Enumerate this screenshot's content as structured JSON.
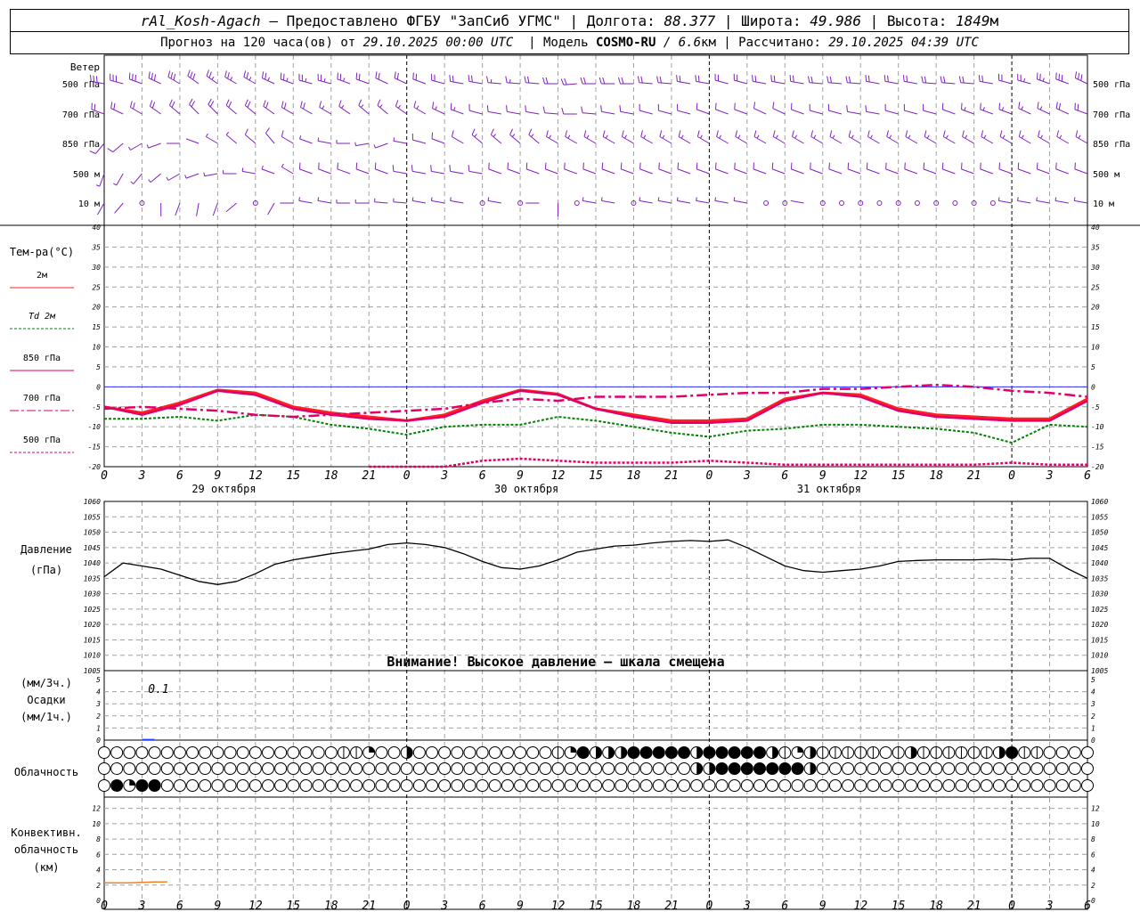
{
  "header": {
    "station": "rAl_Kosh-Agach",
    "provider": "– Предоставлено ФГБУ \"ЗапСиб УГМС\"",
    "lon_label": "Долгота:",
    "lon": "88.377",
    "lat_label": "Широта:",
    "lat": "49.986",
    "alt_label": "Высота:",
    "alt": "1849",
    "alt_unit": "м",
    "forecast_label": "Прогноз на 120 часа(ов) от",
    "forecast_start": "29.10.2025 00:00 UTC",
    "model_label": "Модель",
    "model": "COSMO-RU",
    "model_res": "/ 6.6",
    "model_res_unit": "км",
    "computed_label": "Рассчитано:",
    "computed": "29.10.2025 04:39 UTC"
  },
  "wind_panel": {
    "title": "Ветер",
    "levels": [
      "500 гПа",
      "700 гПа",
      "850 гПа",
      "500 м",
      "10 м"
    ]
  },
  "temp_panel": {
    "title": "Тем-ра(°C)",
    "legend": [
      {
        "label": "2м",
        "color": "#ff2020",
        "dash": "solid"
      },
      {
        "label": "Td 2м",
        "color": "#008000",
        "dash": "dotted"
      },
      {
        "label": "850 гПа",
        "color": "#e0006a",
        "dash": "solid"
      },
      {
        "label": "700 гПа",
        "color": "#e0006a",
        "dash": "dashdot"
      },
      {
        "label": "500 гПа",
        "color": "#e0006a",
        "dash": "dotted"
      }
    ]
  },
  "pressure_panel": {
    "title": "Давление",
    "unit": "(гПа)",
    "warning": "Внимание! Высокое давление – шкала смещена"
  },
  "precip_panel": {
    "unit1": "(мм/3ч.)",
    "title": "Осадки",
    "unit2": "(мм/1ч.)",
    "annotation": "0.1"
  },
  "cloud_panel": {
    "title": "Облачность"
  },
  "conv_panel": {
    "title1": "Конвективн.",
    "title2": "облачность",
    "unit": "(км)"
  },
  "time_axis": {
    "hour_labels": [
      "0",
      "3",
      "6",
      "9",
      "12",
      "15",
      "18",
      "21",
      "0",
      "3",
      "6",
      "9",
      "12",
      "15",
      "18",
      "21",
      "0",
      "3",
      "6",
      "9",
      "12",
      "15",
      "18",
      "21",
      "0",
      "3",
      "6"
    ],
    "day_labels": [
      "29 октября",
      "30 октября",
      "31 октября"
    ]
  },
  "colors": {
    "wind": "#8020c0",
    "t2m": "#ff2020",
    "td2m": "#008000",
    "upper": "#e0006a",
    "pressure": "#000000",
    "conv": "#f08020",
    "freezing_line": "#3030ff",
    "grid": "#a0a0a0"
  },
  "chart_data": [
    {
      "type": "line",
      "title": "Тем-ра(°C)",
      "ylim": [
        -20,
        40
      ],
      "yticks": [
        -20,
        -15,
        -10,
        -5,
        0,
        5,
        10,
        15,
        20,
        25,
        30,
        35,
        40
      ],
      "x_hours": [
        0,
        3,
        6,
        9,
        12,
        15,
        18,
        21,
        24,
        27,
        30,
        33,
        36,
        39,
        42,
        45,
        48,
        51,
        54,
        57,
        60,
        63,
        66,
        69,
        72,
        75,
        78
      ],
      "series": [
        {
          "name": "2м",
          "values": [
            -5,
            -6.5,
            -4,
            -0.8,
            -1.5,
            -5,
            -6.5,
            -7.5,
            -8.5,
            -7,
            -3.5,
            -0.8,
            -1.8,
            -5.5,
            -7,
            -8.5,
            -8.5,
            -8,
            -3,
            -1.5,
            -2,
            -5.5,
            -7,
            -7.5,
            -8,
            -8,
            -3
          ]
        },
        {
          "name": "Td 2м",
          "values": [
            -8,
            -8,
            -7.5,
            -8.5,
            -7,
            -7.5,
            -9.5,
            -10.5,
            -12,
            -10,
            -9.5,
            -9.5,
            -7.5,
            -8.5,
            -10,
            -11.5,
            -12.5,
            -11,
            -10.5,
            -9.5,
            -9.5,
            -10,
            -10.5,
            -11.5,
            -14,
            -9.5,
            -10
          ]
        },
        {
          "name": "850 гПа",
          "values": [
            -5,
            -7,
            -4.5,
            -1,
            -2,
            -5.5,
            -7,
            -8,
            -8.5,
            -7.5,
            -4,
            -1,
            -2,
            -5.5,
            -7.5,
            -9,
            -9,
            -8.5,
            -3.5,
            -1.5,
            -2.5,
            -6,
            -7.5,
            -8,
            -8.5,
            -8.5,
            -3.5
          ]
        },
        {
          "name": "700 гПа",
          "values": [
            -5.5,
            -5,
            -5.5,
            -6,
            -7,
            -7.5,
            -7,
            -6.5,
            -6,
            -5.5,
            -4,
            -3,
            -3.5,
            -2.5,
            -2.5,
            -2.5,
            -2,
            -1.5,
            -1.5,
            -0.5,
            -0.5,
            0,
            0.5,
            0,
            -1,
            -1.5,
            -2.5
          ]
        },
        {
          "name": "500 гПа",
          "values": [
            null,
            null,
            null,
            null,
            null,
            null,
            null,
            -20,
            -20,
            -20,
            -18.5,
            -18,
            -18.5,
            -19,
            -19,
            -19,
            -18.5,
            -19,
            -19.5,
            -19.5,
            -19.5,
            -19.5,
            -19.5,
            -19.5,
            -19,
            -19.5,
            -19.5
          ]
        }
      ]
    },
    {
      "type": "line",
      "title": "Давление",
      "ylim": [
        1005,
        1060
      ],
      "yticks": [
        1005,
        1010,
        1015,
        1020,
        1025,
        1030,
        1035,
        1040,
        1045,
        1050,
        1055,
        1060
      ],
      "x_hours": [
        0,
        1.5,
        3,
        4.5,
        6,
        7.5,
        9,
        10.5,
        12,
        13.5,
        15,
        16.5,
        18,
        19.5,
        21,
        22.5,
        24,
        25.5,
        27,
        28.5,
        30,
        31.5,
        33,
        34.5,
        36,
        37.5,
        39,
        40.5,
        42,
        43.5,
        45,
        46.5,
        48,
        49.5,
        51,
        52.5,
        54,
        55.5,
        57,
        58.5,
        60,
        61.5,
        63,
        64.5,
        66,
        67.5,
        69,
        70.5,
        72,
        73.5,
        75,
        76.5,
        78
      ],
      "series": [
        {
          "name": "Давление",
          "values": [
            1035.5,
            1040,
            1039,
            1038,
            1036,
            1034,
            1033,
            1034,
            1036.5,
            1039.5,
            1041,
            1042,
            1043,
            1043.8,
            1044.5,
            1046,
            1046.5,
            1046,
            1045,
            1043,
            1040.5,
            1038.5,
            1038,
            1039,
            1041,
            1043.5,
            1044.5,
            1045.5,
            1045.8,
            1046.5,
            1047,
            1047.3,
            1047,
            1047.5,
            1045,
            1042,
            1039,
            1037.5,
            1037,
            1037.5,
            1038,
            1039,
            1040.5,
            1040.8,
            1041,
            1041,
            1041,
            1041.2,
            1041,
            1041.5,
            1041.5,
            1038,
            1035
          ]
        }
      ]
    },
    {
      "type": "bar",
      "title": "Осадки",
      "ylim": [
        0,
        5
      ],
      "yticks": [
        0,
        1,
        2,
        3,
        4,
        5
      ],
      "x_hours": [
        3
      ],
      "values": [
        0.1
      ]
    },
    {
      "type": "line",
      "title": "Конвективн. облачность",
      "ylim": [
        0,
        13
      ],
      "yticks": [
        0,
        2,
        4,
        6,
        8,
        10,
        12
      ],
      "x_hours": [
        0,
        1,
        2,
        3,
        4,
        5
      ],
      "series": [
        {
          "name": "Конвективн. облачность",
          "values": [
            2.3,
            2.3,
            2.3,
            2.35,
            2.4,
            2.4
          ]
        }
      ]
    },
    {
      "type": "table",
      "title": "Облачность",
      "step_hours": 1,
      "rows": [
        {
          "level": "upper",
          "values": "0000000000000000000112003000000000001243334444434444431231111101311111134110000000000000000000000000000000000000"
        },
        {
          "level": "middle",
          "values": "0000000000000000000000000000000000000000000000033444444430000000000000000000000000000000000000000000000000000000"
        },
        {
          "level": "low",
          "values": "0424400000000000000000000000000000000000000000000000000000000000000000000000000000000000000000000000000000000000"
        }
      ]
    },
    {
      "type": "scatter",
      "title": "Ветер",
      "note": "direction in degrees (from), speed in m/s, every 1.5 h",
      "x_hours_step": 1.5,
      "levels": [
        {
          "level": "500 гПа",
          "dir": [
            280,
            285,
            290,
            295,
            300,
            305,
            305,
            300,
            300,
            295,
            290,
            285,
            285,
            290,
            290,
            295,
            295,
            290,
            285,
            280,
            280,
            275,
            275,
            275,
            270,
            265,
            270,
            270,
            270,
            275,
            275,
            280,
            280,
            285,
            285,
            280,
            280,
            280,
            275,
            275,
            275,
            280,
            280,
            280,
            275,
            275,
            275,
            280,
            285,
            285,
            290,
            290,
            295
          ],
          "spd": [
            17,
            17,
            16,
            16,
            15,
            15,
            14,
            14,
            14,
            14,
            13,
            13,
            13,
            13,
            12,
            12,
            12,
            12,
            12,
            12,
            10,
            9,
            9,
            10,
            10,
            10,
            10,
            11,
            11,
            11,
            10,
            10,
            10,
            11,
            11,
            11,
            10,
            10,
            10,
            11,
            11,
            11,
            10,
            10,
            10,
            11,
            11,
            11,
            12,
            13,
            14,
            15,
            16
          ]
        },
        {
          "level": "700 гПа",
          "dir": [
            290,
            295,
            300,
            305,
            310,
            315,
            315,
            310,
            310,
            305,
            300,
            300,
            300,
            305,
            310,
            310,
            305,
            300,
            295,
            290,
            285,
            280,
            280,
            280,
            275,
            270,
            275,
            280,
            280,
            285,
            285,
            285,
            290,
            290,
            290,
            295,
            295,
            290,
            285,
            285,
            280,
            280,
            285,
            285,
            285,
            290,
            290,
            290,
            290,
            295,
            295,
            295,
            290
          ],
          "spd": [
            12,
            12,
            12,
            12,
            12,
            12,
            11,
            11,
            11,
            10,
            10,
            10,
            9,
            9,
            9,
            8,
            8,
            8,
            8,
            8,
            6,
            6,
            6,
            6,
            7,
            7,
            7,
            7,
            7,
            6,
            6,
            6,
            7,
            7,
            7,
            7,
            7,
            7,
            7,
            7,
            7,
            7,
            7,
            7,
            7,
            7,
            8,
            8,
            8,
            9,
            9,
            10,
            10
          ]
        },
        {
          "level": "850 гПа",
          "dir": [
            220,
            230,
            240,
            250,
            270,
            290,
            300,
            310,
            310,
            320,
            300,
            290,
            280,
            270,
            260,
            250,
            280,
            285,
            290,
            300,
            310,
            310,
            310,
            310,
            300,
            300,
            300,
            300,
            300,
            300,
            300,
            300,
            300,
            300,
            300,
            300,
            300,
            300,
            300,
            300,
            300,
            300,
            300,
            300,
            300,
            300,
            300,
            300,
            300,
            300,
            300,
            300,
            300
          ],
          "spd": [
            6,
            5,
            4,
            3,
            2,
            2,
            3,
            4,
            5,
            6,
            5,
            4,
            3,
            3,
            3,
            3,
            4,
            5,
            6,
            7,
            8,
            8,
            8,
            8,
            8,
            8,
            8,
            8,
            8,
            8,
            8,
            8,
            8,
            8,
            8,
            8,
            8,
            8,
            8,
            8,
            8,
            8,
            8,
            8,
            8,
            8,
            8,
            8,
            8,
            8,
            8,
            8,
            8
          ]
        },
        {
          "level": "500 м",
          "dir": [
            200,
            210,
            220,
            230,
            240,
            250,
            260,
            270,
            280,
            290,
            300,
            290,
            290,
            290,
            290,
            290,
            280,
            280,
            280,
            280,
            280,
            290,
            290,
            290,
            290,
            290,
            290,
            290,
            290,
            290,
            290,
            290,
            290,
            290,
            290,
            290,
            290,
            290,
            290,
            290,
            290,
            290,
            290,
            290,
            290,
            290,
            290,
            290,
            290,
            290,
            290,
            290,
            290
          ],
          "spd": [
            4,
            4,
            4,
            3,
            3,
            3,
            3,
            3,
            4,
            4,
            4,
            5,
            5,
            5,
            5,
            5,
            5,
            5,
            5,
            5,
            5,
            5,
            5,
            5,
            5,
            5,
            5,
            5,
            5,
            5,
            5,
            5,
            5,
            5,
            5,
            5,
            5,
            5,
            5,
            5,
            5,
            5,
            5,
            5,
            5,
            5,
            5,
            5,
            5,
            5,
            5,
            5,
            5
          ]
        },
        {
          "level": "10 м",
          "dir": [
            210,
            220,
            0,
            180,
            200,
            190,
            200,
            230,
            0,
            210,
            270,
            280,
            280,
            270,
            270,
            275,
            275,
            280,
            280,
            280,
            0,
            280,
            0,
            270,
            180,
            0,
            280,
            280,
            0,
            280,
            280,
            280,
            280,
            280,
            280,
            0,
            0,
            280,
            0,
            0,
            0,
            0,
            0,
            0,
            0,
            0,
            0,
            0,
            280,
            280,
            280,
            280,
            280
          ],
          "spd": [
            2,
            2,
            0,
            2,
            2,
            2,
            2,
            1,
            0,
            1,
            2,
            3,
            3,
            3,
            3,
            3,
            3,
            3,
            3,
            3,
            0,
            3,
            0,
            2,
            2,
            0,
            3,
            3,
            0,
            3,
            3,
            3,
            3,
            3,
            3,
            0,
            0,
            2,
            0,
            0,
            0,
            0,
            0,
            0,
            0,
            0,
            0,
            0,
            3,
            3,
            3,
            3,
            3
          ]
        }
      ]
    }
  ]
}
